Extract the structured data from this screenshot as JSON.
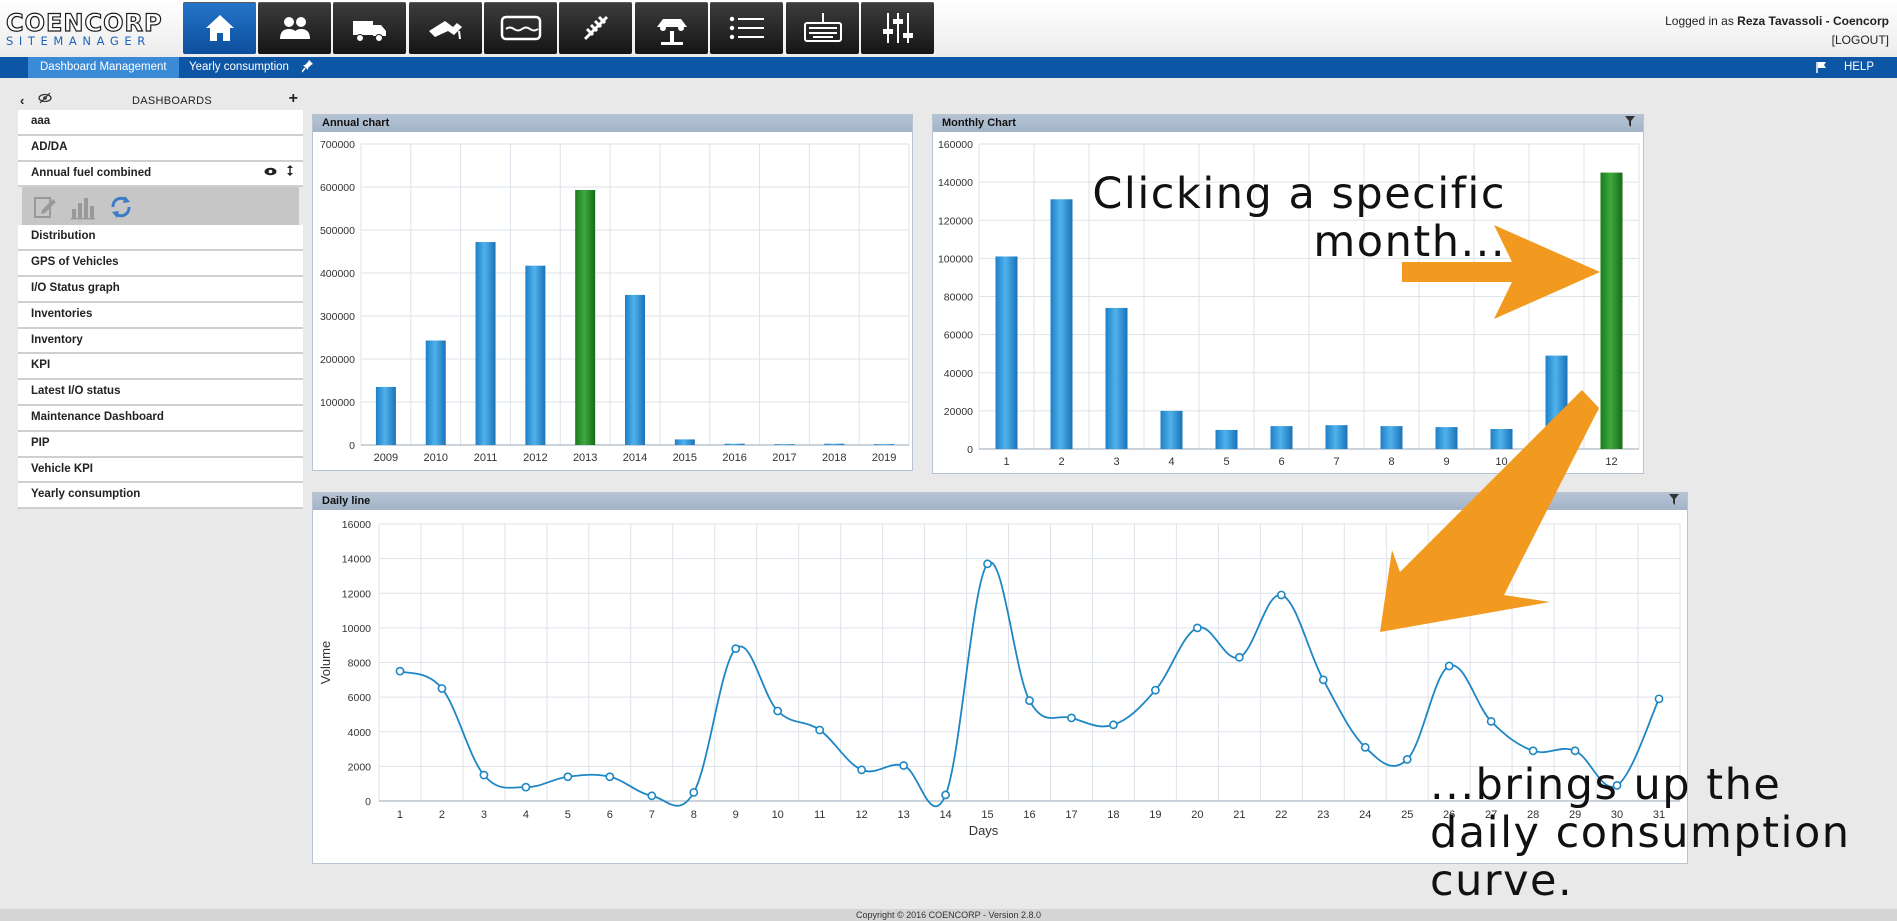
{
  "app": {
    "logo_line1": "COENCORP",
    "logo_line2": "SITEMANAGER",
    "brand_color": "#0d56a6",
    "accent_color": "#f29a1f"
  },
  "nav_icons": [
    "home-icon",
    "users-icon",
    "vehicles-icon",
    "fuel-nozzle-icon",
    "tank-icon",
    "spring-icon",
    "car-lift-icon",
    "list-icon",
    "keyboard-icon",
    "sliders-icon"
  ],
  "login": {
    "prefix": "Logged in as",
    "user": "Reza Tavassoli - Coencorp",
    "logout": "[LOGOUT]"
  },
  "subbar": {
    "tab_active": "Dashboard Management",
    "tab_current": "Yearly consumption",
    "help": "HELP"
  },
  "sidebar": {
    "title": "DASHBOARDS",
    "items_top": [
      "aaa",
      "AD/DA",
      "Annual fuel combined"
    ],
    "items_bottom": [
      "Distribution",
      "GPS of Vehicles",
      "I/O Status graph",
      "Inventories",
      "Inventory",
      "KPI",
      "Latest I/O status",
      "Maintenance Dashboard",
      "PIP",
      "Vehicle KPI",
      "Yearly consumption"
    ]
  },
  "panels": {
    "annual": "Annual chart",
    "monthly": "Monthly Chart",
    "daily": "Daily line"
  },
  "chart_data": [
    {
      "type": "bar",
      "categories": [
        "2009",
        "2010",
        "2011",
        "2012",
        "2013",
        "2014",
        "2015",
        "2016",
        "2017",
        "2018",
        "2019"
      ],
      "values": [
        135000,
        243000,
        472000,
        417000,
        593000,
        349000,
        13000,
        3000,
        2000,
        3000,
        2000
      ],
      "highlight": "2013",
      "ylim": [
        0,
        700000
      ],
      "yticks": [
        0,
        100000,
        200000,
        300000,
        400000,
        500000,
        600000,
        700000
      ],
      "grid": true
    },
    {
      "type": "bar",
      "categories": [
        "1",
        "2",
        "3",
        "4",
        "5",
        "6",
        "7",
        "8",
        "9",
        "10",
        "11",
        "12"
      ],
      "values": [
        101000,
        131000,
        74000,
        20000,
        10000,
        12000,
        12500,
        12000,
        11500,
        10500,
        49000,
        145000
      ],
      "highlight": "12",
      "visible_tick_labels": [
        "1",
        "2",
        "3",
        "4",
        "5",
        "6",
        "7",
        "8",
        "9",
        "10",
        "",
        "12"
      ],
      "ylim": [
        0,
        160000
      ],
      "yticks": [
        0,
        20000,
        40000,
        60000,
        80000,
        100000,
        120000,
        140000,
        160000
      ],
      "grid": true
    },
    {
      "type": "line",
      "x": [
        1,
        2,
        3,
        4,
        5,
        6,
        7,
        8,
        9,
        10,
        11,
        12,
        13,
        14,
        15,
        16,
        17,
        18,
        19,
        20,
        21,
        22,
        23,
        24,
        25,
        26,
        27,
        28,
        29,
        30,
        31
      ],
      "values": [
        7500,
        6500,
        1500,
        800,
        1400,
        1400,
        300,
        500,
        8800,
        5200,
        4100,
        1800,
        2050,
        350,
        13700,
        5800,
        4800,
        4400,
        6400,
        10000,
        8300,
        11900,
        7000,
        3100,
        2400,
        7800,
        4600,
        2900,
        2900,
        900,
        5900
      ],
      "xlabel": "Days",
      "ylabel": "Volume",
      "ylim": [
        0,
        16000
      ],
      "yticks": [
        0,
        2000,
        4000,
        6000,
        8000,
        10000,
        12000,
        14000,
        16000
      ],
      "grid": true
    }
  ],
  "annotations": {
    "top": [
      "Clicking a specific",
      "month..."
    ],
    "bottom": [
      "...brings up the",
      "daily consumption",
      "curve."
    ]
  },
  "footer": "Copyright © 2016 COENCORP - Version 2.8.0"
}
